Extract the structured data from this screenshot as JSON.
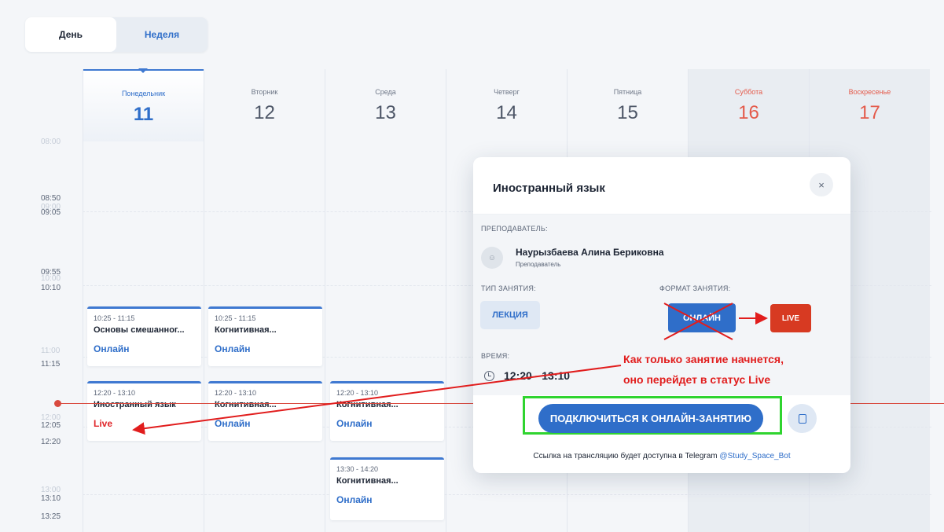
{
  "view_toggle": {
    "day_label": "День",
    "week_label": "Неделя"
  },
  "time_ticks": [
    {
      "label": "08:00",
      "ghost": true
    },
    {
      "label": "08:50",
      "ghost": false
    },
    {
      "label": "09:00",
      "ghost": true
    },
    {
      "label": "09:05",
      "ghost": false
    },
    {
      "label": "09:55",
      "ghost": false
    },
    {
      "label": "10:00",
      "ghost": true
    },
    {
      "label": "10:10",
      "ghost": false
    },
    {
      "label": "11:00",
      "ghost": true
    },
    {
      "label": "11:15",
      "ghost": false
    },
    {
      "label": "12:00",
      "ghost": true
    },
    {
      "label": "12:05",
      "ghost": false
    },
    {
      "label": "12:20",
      "ghost": false
    },
    {
      "label": "13:00",
      "ghost": true
    },
    {
      "label": "13:10",
      "ghost": false
    },
    {
      "label": "13:25",
      "ghost": false
    }
  ],
  "days": [
    {
      "name": "Понедельник",
      "number": "11",
      "today": true,
      "weekend": false
    },
    {
      "name": "Вторник",
      "number": "12",
      "today": false,
      "weekend": false
    },
    {
      "name": "Среда",
      "number": "13",
      "today": false,
      "weekend": false
    },
    {
      "name": "Четверг",
      "number": "14",
      "today": false,
      "weekend": false
    },
    {
      "name": "Пятница",
      "number": "15",
      "today": false,
      "weekend": false
    },
    {
      "name": "Суббота",
      "number": "16",
      "today": false,
      "weekend": true
    },
    {
      "name": "Воскресенье",
      "number": "17",
      "today": false,
      "weekend": true
    }
  ],
  "events": [
    {
      "day": 0,
      "time": "10:25 - 11:15",
      "title": "Основы смешанног...",
      "status": "Онлайн",
      "live": false
    },
    {
      "day": 1,
      "time": "10:25 - 11:15",
      "title": "Когнитивная...",
      "status": "Онлайн",
      "live": false
    },
    {
      "day": 0,
      "time": "12:20 - 13:10",
      "title": "Иностранный язык",
      "status": "Live",
      "live": true
    },
    {
      "day": 1,
      "time": "12:20 - 13:10",
      "title": "Когнитивная...",
      "status": "Онлайн",
      "live": false
    },
    {
      "day": 2,
      "time": "12:20 - 13:10",
      "title": "Когнитивная...",
      "status": "Онлайн",
      "live": false
    },
    {
      "day": 2,
      "time": "13:30 - 14:20",
      "title": "Когнитивная...",
      "status": "Онлайн",
      "live": false
    }
  ],
  "popup": {
    "title": "Иностранный язык",
    "close": "×",
    "teacher_label": "ПРЕПОДАВАТЕЛЬ:",
    "teacher_name": "Наурызбаева Алина Бериковна",
    "teacher_role": "Преподаватель",
    "type_label": "ТИП ЗАНЯТИЯ:",
    "type_value": "ЛЕКЦИЯ",
    "format_label": "ФОРМАТ ЗАНЯТИЯ:",
    "format_value": "ОНЛАЙН",
    "format_new": "LIVE",
    "time_label": "ВРЕМЯ:",
    "time_value": "12:20 - 13:10",
    "connect_button": "ПОДКЛЮЧИТЬСЯ К ОНЛАЙН-ЗАНЯТИЮ",
    "footnote_text": "Ссылка на трансляцию будет доступна в Telegram ",
    "footnote_link": "@Study_Space_Bot"
  },
  "annotation": {
    "line1": "Как только занятие начнется,",
    "line2": "оно перейдет в статус Live",
    "color": "#e11d1d",
    "highlight_color": "#2fd42f"
  },
  "colors": {
    "accent": "#2f6ec9",
    "weekend": "#e45a4a",
    "live": "#e0262a",
    "now_line": "#d94a3f"
  }
}
